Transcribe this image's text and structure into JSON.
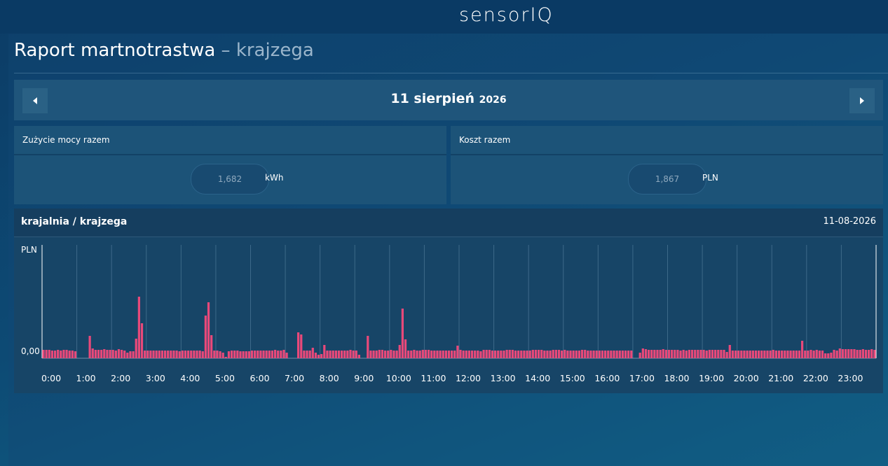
{
  "app": {
    "logo": "sensorIQ"
  },
  "page": {
    "title": "Raport martnotrastwa",
    "separator": "–",
    "subtitle": "krajzega"
  },
  "date_nav": {
    "day_month": "11 sierpień",
    "year": "2026"
  },
  "summary": {
    "energy": {
      "label": "Zużycie mocy razem",
      "value": "1,682",
      "unit": "kWh"
    },
    "cost": {
      "label": "Koszt razem",
      "value": "1,867",
      "unit": "PLN"
    }
  },
  "chart_panel": {
    "title": "krajalnia / krajzega",
    "date": "11-08-2026"
  },
  "colors": {
    "bar": "#e8497a",
    "background": "#174567",
    "accent": "#ffffff"
  },
  "chart_data": {
    "type": "bar",
    "ylabel": "PLN",
    "y_ticks": [
      "0,00"
    ],
    "x_tick_labels": [
      "0:00",
      "1:00",
      "2:00",
      "3:00",
      "4:00",
      "5:00",
      "6:00",
      "7:00",
      "8:00",
      "9:00",
      "10:00",
      "11:00",
      "12:00",
      "13:00",
      "14:00",
      "15:00",
      "16:00",
      "17:00",
      "18:00",
      "19:00",
      "20:00",
      "21:00",
      "22:00",
      "23:00"
    ],
    "interval_minutes": 5,
    "grid": "vertical",
    "values": [
      0.012,
      0.012,
      0.012,
      0.011,
      0.011,
      0.012,
      0.011,
      0.012,
      0.012,
      0.011,
      0.011,
      0.01,
      0.0,
      0.0,
      0.0,
      0.0,
      0.032,
      0.014,
      0.012,
      0.012,
      0.012,
      0.013,
      0.012,
      0.012,
      0.012,
      0.011,
      0.013,
      0.012,
      0.011,
      0.008,
      0.01,
      0.01,
      0.028,
      0.088,
      0.05,
      0.011,
      0.011,
      0.011,
      0.011,
      0.011,
      0.011,
      0.011,
      0.011,
      0.011,
      0.011,
      0.011,
      0.011,
      0.01,
      0.011,
      0.011,
      0.011,
      0.011,
      0.011,
      0.011,
      0.011,
      0.01,
      0.061,
      0.08,
      0.033,
      0.011,
      0.011,
      0.01,
      0.008,
      0.002,
      0.01,
      0.011,
      0.011,
      0.011,
      0.01,
      0.01,
      0.01,
      0.01,
      0.011,
      0.011,
      0.011,
      0.011,
      0.011,
      0.011,
      0.011,
      0.011,
      0.012,
      0.011,
      0.011,
      0.012,
      0.008,
      0.0,
      0.0,
      0.0,
      0.037,
      0.034,
      0.011,
      0.011,
      0.011,
      0.015,
      0.008,
      0.005,
      0.006,
      0.019,
      0.011,
      0.011,
      0.011,
      0.011,
      0.011,
      0.011,
      0.011,
      0.011,
      0.012,
      0.011,
      0.011,
      0.005,
      0.0,
      0.0,
      0.032,
      0.011,
      0.011,
      0.011,
      0.012,
      0.012,
      0.011,
      0.011,
      0.012,
      0.011,
      0.011,
      0.019,
      0.071,
      0.027,
      0.011,
      0.011,
      0.012,
      0.011,
      0.011,
      0.012,
      0.012,
      0.012,
      0.011,
      0.011,
      0.011,
      0.011,
      0.011,
      0.011,
      0.011,
      0.011,
      0.011,
      0.018,
      0.012,
      0.011,
      0.011,
      0.011,
      0.011,
      0.011,
      0.011,
      0.01,
      0.012,
      0.012,
      0.012,
      0.011,
      0.011,
      0.011,
      0.011,
      0.011,
      0.012,
      0.012,
      0.012,
      0.011,
      0.011,
      0.011,
      0.011,
      0.011,
      0.011,
      0.012,
      0.012,
      0.012,
      0.012,
      0.011,
      0.011,
      0.011,
      0.012,
      0.012,
      0.012,
      0.011,
      0.012,
      0.011,
      0.011,
      0.011,
      0.011,
      0.011,
      0.012,
      0.012,
      0.011,
      0.011,
      0.011,
      0.011,
      0.011,
      0.011,
      0.011,
      0.011,
      0.011,
      0.011,
      0.011,
      0.011,
      0.011,
      0.011,
      0.011,
      0.011,
      0.0,
      0.0,
      0.008,
      0.014,
      0.013,
      0.012,
      0.012,
      0.012,
      0.012,
      0.012,
      0.013,
      0.012,
      0.012,
      0.012,
      0.012,
      0.012,
      0.011,
      0.012,
      0.011,
      0.012,
      0.012,
      0.012,
      0.012,
      0.012,
      0.012,
      0.011,
      0.012,
      0.012,
      0.012,
      0.012,
      0.012,
      0.012,
      0.009,
      0.019,
      0.011,
      0.011,
      0.011,
      0.011,
      0.011,
      0.011,
      0.011,
      0.011,
      0.011,
      0.011,
      0.011,
      0.011,
      0.011,
      0.011,
      0.012,
      0.011,
      0.011,
      0.011,
      0.011,
      0.011,
      0.011,
      0.011,
      0.011,
      0.011,
      0.025,
      0.011,
      0.011,
      0.012,
      0.011,
      0.012,
      0.011,
      0.011,
      0.007,
      0.007,
      0.008,
      0.012,
      0.011,
      0.014,
      0.013,
      0.013,
      0.013,
      0.013,
      0.013,
      0.012,
      0.012,
      0.013,
      0.012,
      0.012,
      0.013,
      0.012
    ]
  }
}
